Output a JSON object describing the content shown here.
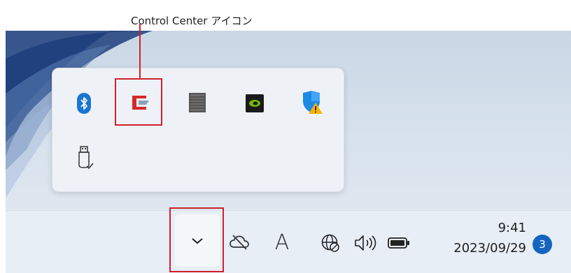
{
  "annotation": {
    "label": "Control Center アイコン",
    "highlight_color": "#d0202a"
  },
  "overflow_panel": {
    "icons": [
      {
        "name": "bluetooth-icon"
      },
      {
        "name": "control-center-icon"
      },
      {
        "name": "unknown-app-icon"
      },
      {
        "name": "nvidia-icon"
      },
      {
        "name": "windows-security-warning-icon"
      },
      {
        "name": "usb-eject-icon"
      }
    ]
  },
  "taskbar": {
    "chevron": "show-hidden-icons",
    "ime_label": "A",
    "time": "9:41",
    "date": "2023/09/29",
    "notification_count": "3"
  }
}
